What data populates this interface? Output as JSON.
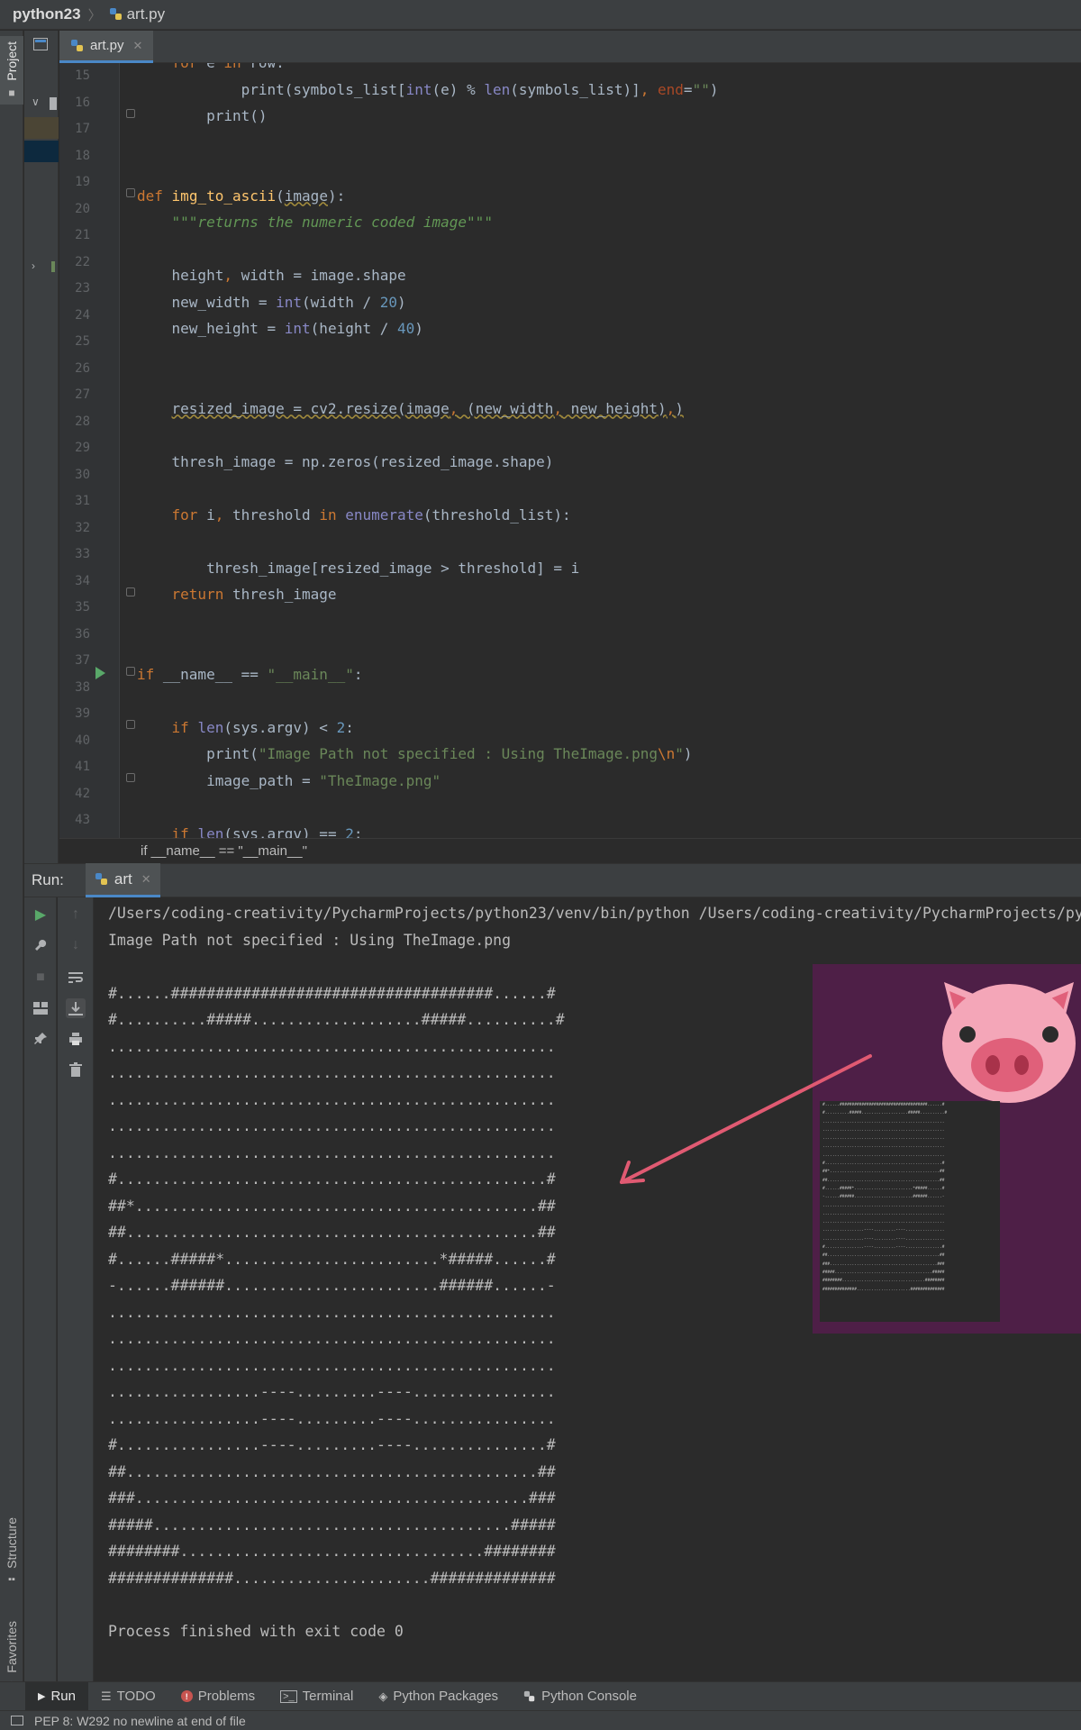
{
  "navbar": {
    "project": "python23",
    "file": "art.py"
  },
  "left_strip": {
    "project_tab": "Project",
    "structure_tab": "Structure",
    "favorites_tab": "Favorites"
  },
  "editor": {
    "tab_label": "art.py",
    "breadcrumb": "if __name__ == \"__main__\"",
    "line_numbers": [
      "15",
      "16",
      "17",
      "18",
      "19",
      "20",
      "21",
      "22",
      "23",
      "24",
      "25",
      "26",
      "27",
      "28",
      "29",
      "30",
      "31",
      "32",
      "33",
      "34",
      "35",
      "36",
      "37",
      "38",
      "39",
      "40",
      "41",
      "42",
      "43"
    ]
  },
  "run": {
    "title": "Run:",
    "tab_label": "art",
    "console": [
      "/Users/coding-creativity/PycharmProjects/python23/venv/bin/python /Users/coding-creativity/PycharmProjects/python23/art.py",
      "Image Path not specified : Using TheImage.png",
      "",
      "#......####################################......#",
      "#..........#####...................#####..........#",
      "..................................................",
      "..................................................",
      "..................................................",
      "..................................................",
      "..................................................",
      "#................................................#",
      "##*.............................................##",
      "##..............................................##",
      "#......#####*........................*#####......#",
      "-......######........................######......-",
      "..................................................",
      "..................................................",
      "..................................................",
      ".................----.........----................",
      ".................----.........----................",
      "#................----.........----...............#",
      "##..............................................##",
      "###............................................###",
      "#####........................................#####",
      "########..................................########",
      "##############......................##############",
      "",
      "Process finished with exit code 0"
    ]
  },
  "bottom_tabs": [
    "Run",
    "TODO",
    "Problems",
    "Terminal",
    "Python Packages",
    "Python Console"
  ],
  "status": {
    "message": "PEP 8: W292 no newline at end of file"
  },
  "colors": {
    "accent": "#4a88c7",
    "overlay_bg": "#4e1f47",
    "pig": "#f4a6b8",
    "arrow": "#e05a72"
  }
}
